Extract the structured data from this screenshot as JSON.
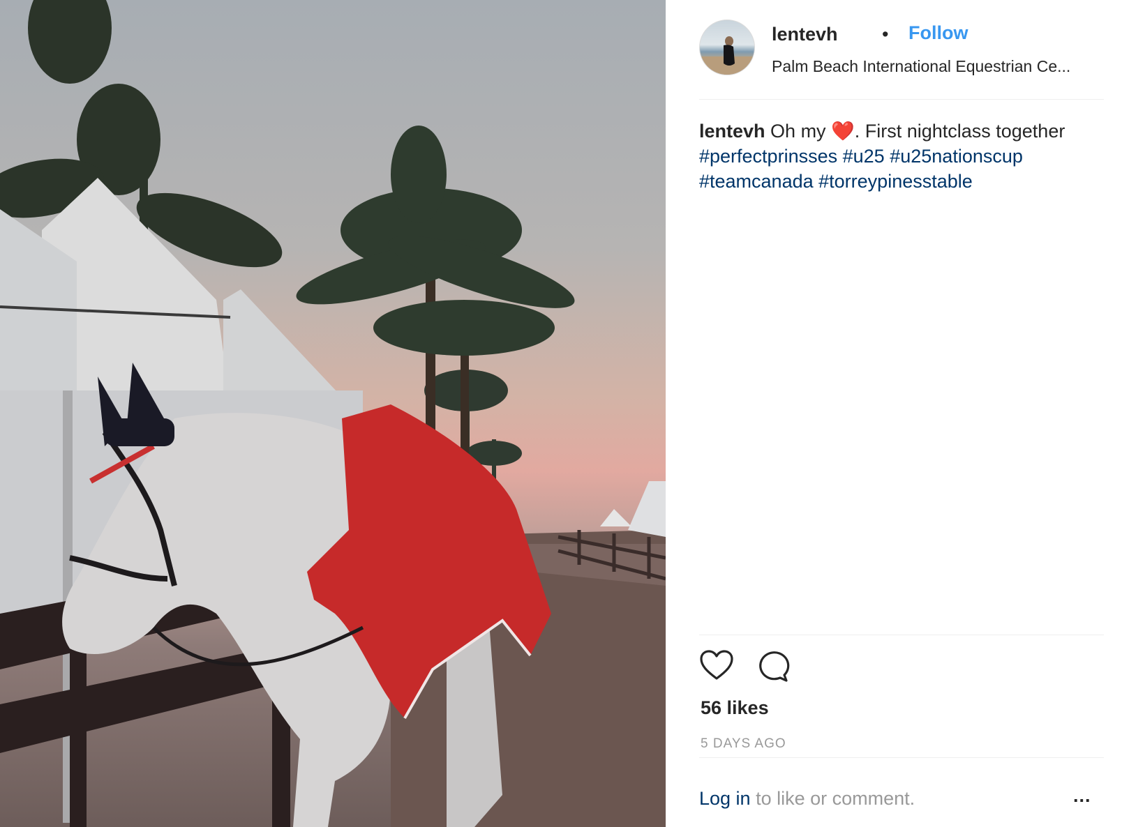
{
  "post": {
    "username": "lentevh",
    "separator": "•",
    "follow_label": "Follow",
    "location": "Palm Beach International Equestrian Ce...",
    "caption": {
      "username": "lentevh",
      "text_before": "Oh my",
      "emoji": "❤️",
      "text_after": ". First nightclass together",
      "hashtags": [
        "#perfectprinsses",
        "#u25",
        "#u25nationscup",
        "#teamcanada",
        "#torreypinesstable"
      ]
    },
    "likes": "56 likes",
    "time": "5 DAYS AGO",
    "footer": {
      "login_label": "Log in",
      "rest": " to like or comment."
    },
    "more_label": "..."
  },
  "icons": {
    "like": "heart-icon",
    "comment": "comment-bubble-icon",
    "more": "more-options-icon"
  },
  "colors": {
    "follow": "#3897f0",
    "hashtag": "#003569",
    "muted": "#999999",
    "text": "#262626"
  }
}
